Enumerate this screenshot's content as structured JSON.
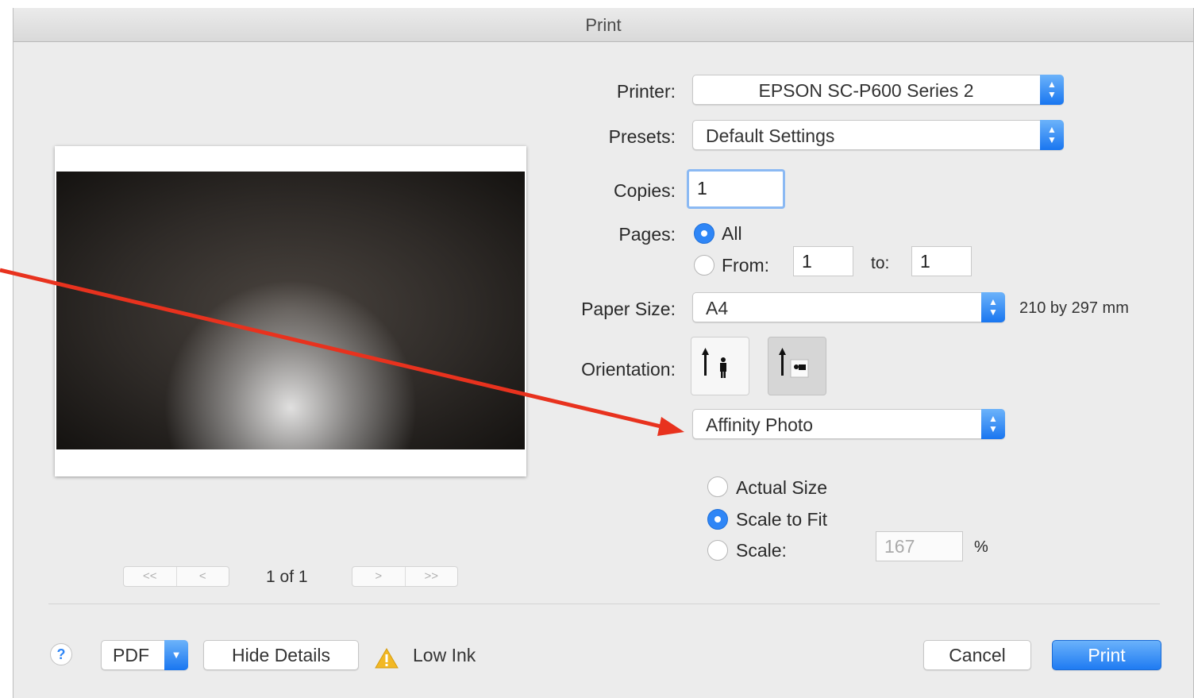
{
  "dialog": {
    "title": "Print"
  },
  "printer": {
    "label": "Printer:",
    "value": "EPSON SC-P600 Series 2"
  },
  "presets": {
    "label": "Presets:",
    "value": "Default Settings"
  },
  "copies": {
    "label": "Copies:",
    "value": "1"
  },
  "pages": {
    "label": "Pages:",
    "all_label": "All",
    "from_label": "From:",
    "from_value": "1",
    "to_label": "to:",
    "to_value": "1",
    "selected": "All"
  },
  "paper_size": {
    "label": "Paper Size:",
    "value": "A4",
    "dimensions": "210 by 297 mm"
  },
  "orientation": {
    "label": "Orientation:",
    "selected": "landscape"
  },
  "section_popup": {
    "value": "Affinity Photo"
  },
  "scaling": {
    "actual_size_label": "Actual Size",
    "scale_to_fit_label": "Scale to Fit",
    "scale_label": "Scale:",
    "scale_value": "167",
    "percent": "%",
    "selected": "Scale to Fit"
  },
  "preview": {
    "page_indicator": "1 of 1",
    "first": "<<",
    "prev": "<",
    "next": ">",
    "last": ">>"
  },
  "footer": {
    "help": "?",
    "pdf_label": "PDF",
    "hide_details_label": "Hide Details",
    "low_ink_label": "Low Ink",
    "cancel_label": "Cancel",
    "print_label": "Print"
  },
  "colors": {
    "accent": "#2f86f6",
    "annotation_arrow": "#e8321e"
  }
}
